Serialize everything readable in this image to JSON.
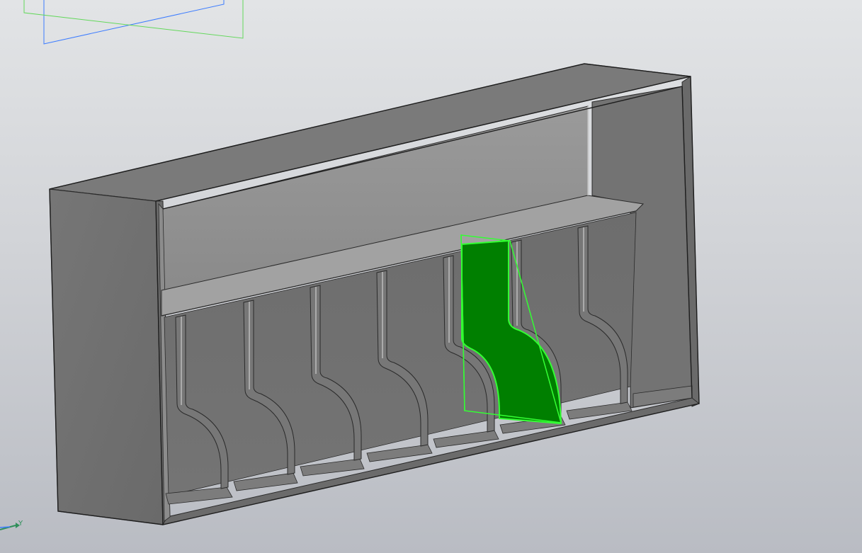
{
  "viewport": {
    "axis_y_label": "Y",
    "colors": {
      "background_top": "#e2e4e6",
      "background_bottom": "#b9bcc3",
      "model_outer": "#6f6f6f",
      "model_face_light": "#9a9a9a",
      "model_face_dark": "#555555",
      "edge": "#2a2a2a",
      "selected_face": "#007f00",
      "selected_outline": "#33ff33",
      "plane_blue": "#3c7cff",
      "plane_green": "#63d85b",
      "axis_color": "#2f8f5a"
    },
    "icons": [
      "coordinate-axes-icon"
    ]
  }
}
